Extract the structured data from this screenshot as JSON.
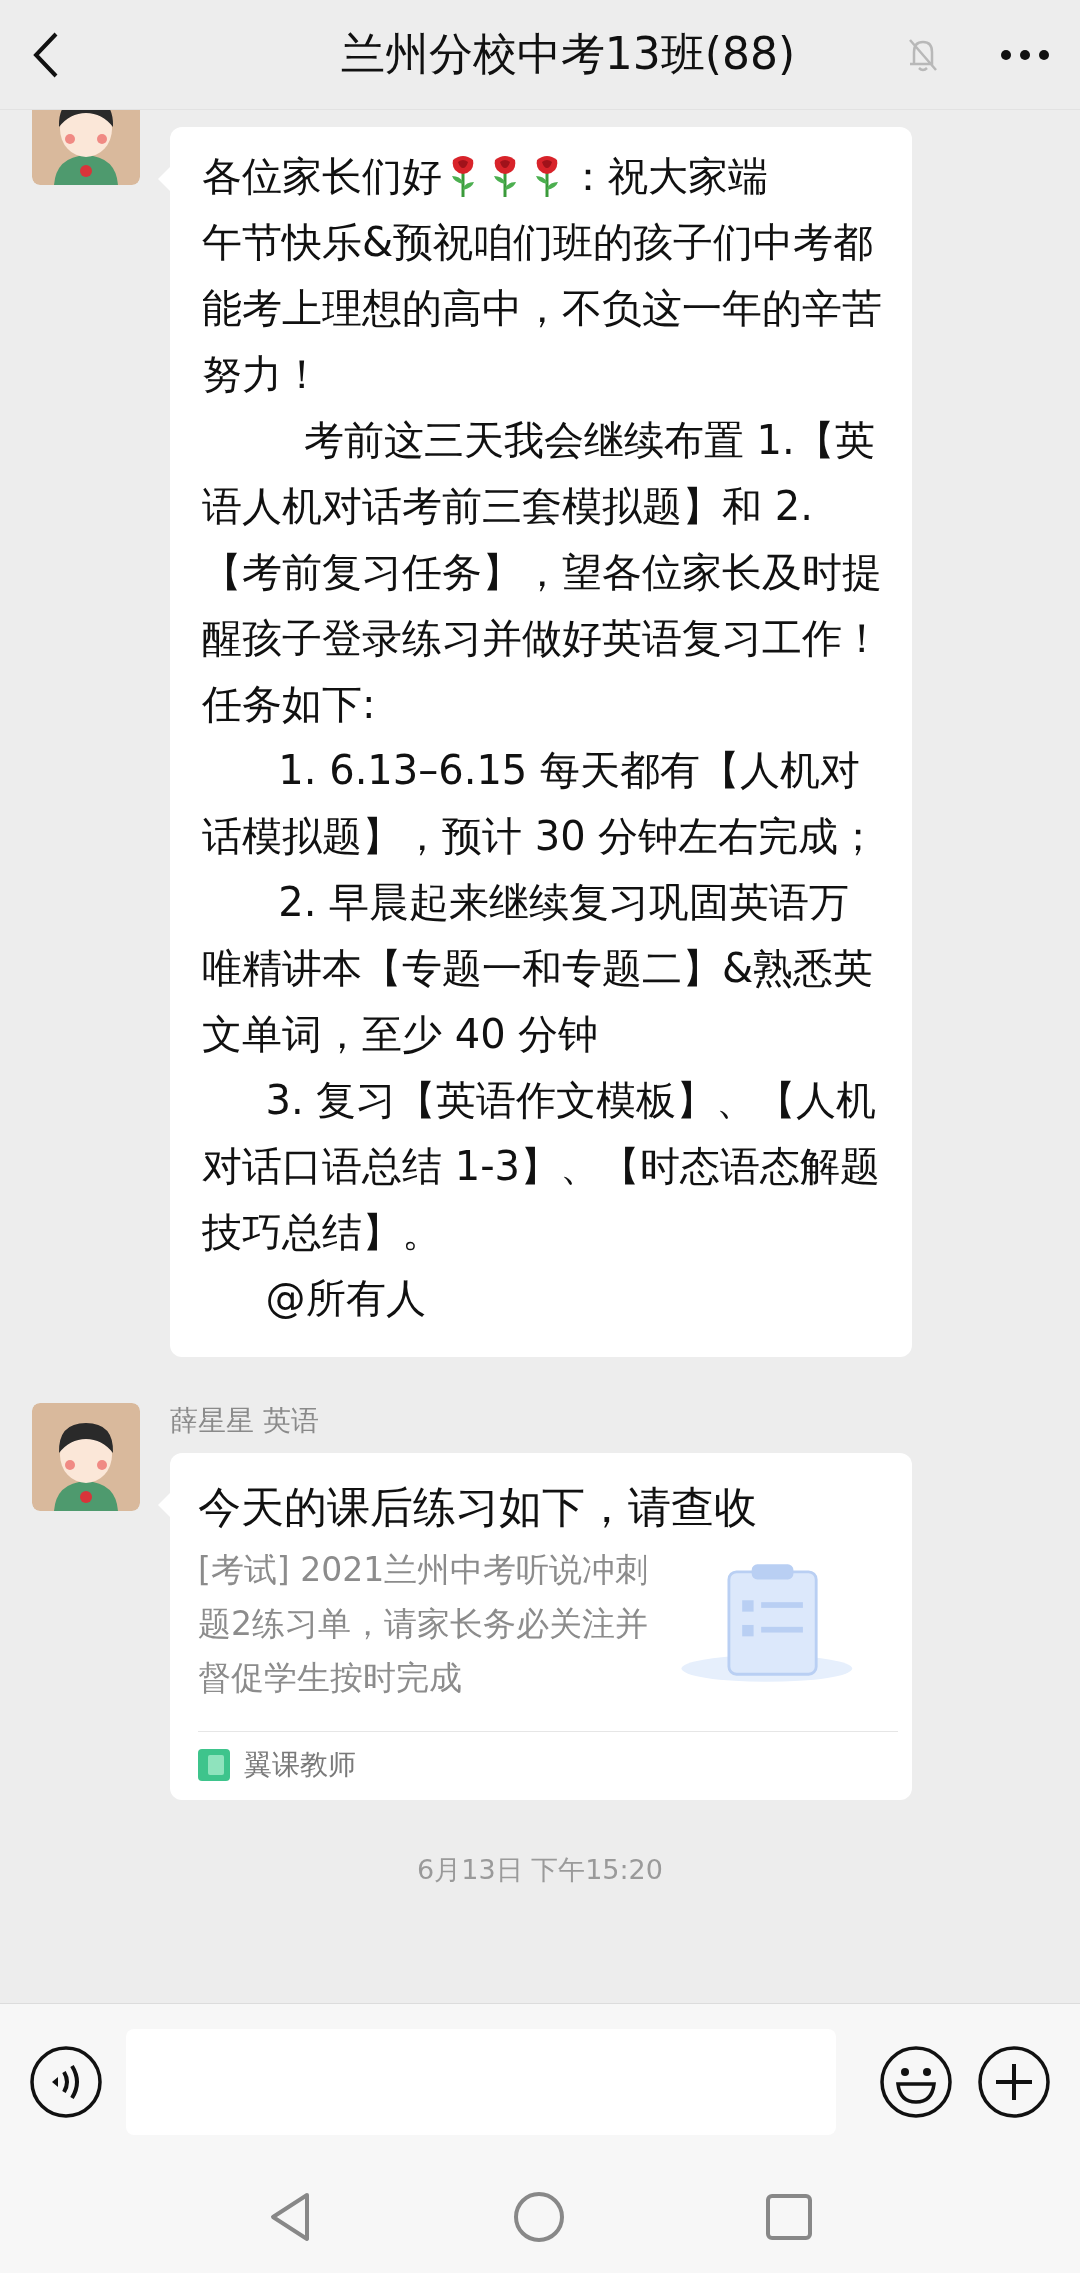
{
  "header": {
    "title": "兰州分校中考13班(88)",
    "muted": true
  },
  "messages": [
    {
      "kind": "text",
      "paragraphs": [
        [
          {
            "kind": "text",
            "text": "各位家长们好"
          },
          {
            "kind": "rose"
          },
          {
            "kind": "rose"
          },
          {
            "kind": "rose"
          },
          {
            "kind": "text",
            "text": "：祝大家端"
          }
        ],
        [
          {
            "kind": "text",
            "text": "午节快乐&预祝咱们班的孩子们中考都能考上理想的高中，不负这一年的辛苦努力！"
          }
        ],
        [
          {
            "kind": "text",
            "text": "        考前这三天我会继续布置 1.【英语人机对话考前三套模拟题】和 2.【考前复习任务】，望各位家长及时提醒孩子登录练习并做好英语复习工作！任务如下:"
          }
        ],
        [
          {
            "kind": "text",
            "text": "      1. 6.13–6.15 每天都有【人机对话模拟题】，预计 30 分钟左右完成；"
          }
        ],
        [
          {
            "kind": "text",
            "text": "      2. 早晨起来继续复习巩固英语万唯精讲本【专题一和专题二】&熟悉英文单词，至少 40 分钟"
          }
        ],
        [
          {
            "kind": "text",
            "text": "     3. 复习【英语作文模板】、【人机对话口语总结 1-3】、【时态语态解题技巧总结】。"
          }
        ],
        [
          {
            "kind": "text",
            "text": "     @所有人"
          }
        ]
      ]
    },
    {
      "kind": "card",
      "sender": "薛星星 英语",
      "title": "今天的课后练习如下，请查收",
      "description": "[考试] 2021兰州中考听说冲刺题2练习单，请家长务必关注并督促学生按时完成",
      "source": "翼课教师"
    }
  ],
  "timestamp": "6月13日 下午15:20"
}
